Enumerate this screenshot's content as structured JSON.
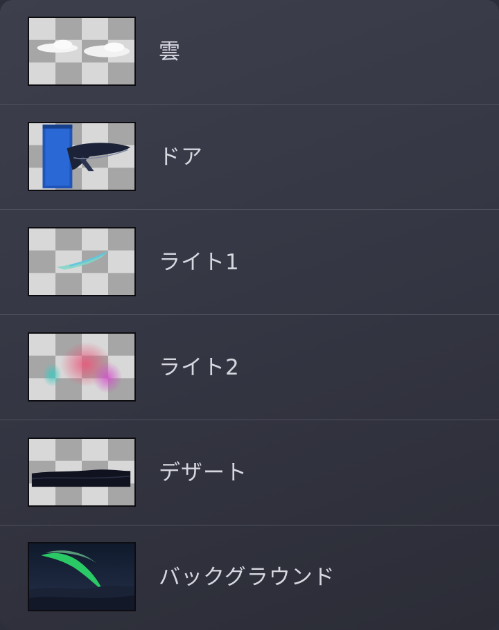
{
  "layers": [
    {
      "name": "雲",
      "thumbnail": "clouds-thumbnail"
    },
    {
      "name": "ドア",
      "thumbnail": "door-whale-thumbnail"
    },
    {
      "name": "ライト1",
      "thumbnail": "light-streak-thumbnail"
    },
    {
      "name": "ライト2",
      "thumbnail": "colored-glow-thumbnail"
    },
    {
      "name": "デザート",
      "thumbnail": "desert-thumbnail"
    },
    {
      "name": "バックグラウンド",
      "thumbnail": "aurora-background-thumbnail"
    }
  ],
  "colors": {
    "panel_background": "#3a3c49",
    "text": "#d6d7df",
    "divider": "#505260",
    "checker_light": "#d8d8d8",
    "checker_dark": "#a6a6a6"
  }
}
